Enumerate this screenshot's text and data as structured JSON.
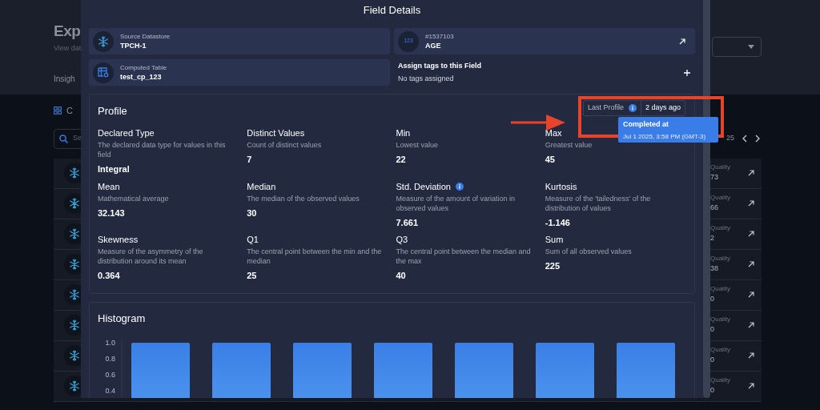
{
  "background_page": {
    "title": "Exp",
    "subtitle": "View dat",
    "tab": "Insigh",
    "section_label": "C",
    "search_placeholder": "Se",
    "pagination": "25",
    "rows": [
      {
        "quality_label": "Quality",
        "quality": "73"
      },
      {
        "quality_label": "Quality",
        "quality": "66"
      },
      {
        "quality_label": "Quality",
        "quality": "2"
      },
      {
        "quality_label": "Quality",
        "quality": "38"
      },
      {
        "quality_label": "Quality",
        "quality": "0"
      },
      {
        "quality_label": "Quality",
        "quality": "0"
      },
      {
        "quality_label": "Quality",
        "quality": "0"
      },
      {
        "quality_label": "Quality",
        "quality": "0"
      }
    ]
  },
  "modal": {
    "title": "Field Details",
    "cards": [
      {
        "kind": "datastore",
        "label": "Source Datastore",
        "value": "TPCH-1"
      },
      {
        "kind": "field",
        "label": "#1537103",
        "value": "AGE",
        "icon_text": "123"
      },
      {
        "kind": "table",
        "label": "Computed Table",
        "value": "test_cp_123"
      }
    ],
    "tags": {
      "title": "Assign tags to this Field",
      "value": "No tags assigned"
    },
    "profile": {
      "title": "Profile",
      "last_profile": {
        "label": "Last Profile",
        "value": "2 days ago"
      },
      "tooltip": {
        "title": "Completed at",
        "value": "Jul 1 2025, 3:58 PM (GMT-3)"
      },
      "stats": [
        {
          "name": "Declared Type",
          "description": "The declared data type for values in this field",
          "value": "Integral",
          "info": false
        },
        {
          "name": "Distinct Values",
          "description": "Count of distinct values",
          "value": "7",
          "info": false
        },
        {
          "name": "Min",
          "description": "Lowest value",
          "value": "22",
          "info": false
        },
        {
          "name": "Max",
          "description": "Greatest value",
          "value": "45",
          "info": false
        },
        {
          "name": "Mean",
          "description": "Mathematical average",
          "value": "32.143",
          "info": false
        },
        {
          "name": "Median",
          "description": "The median of the observed values",
          "value": "30",
          "info": false
        },
        {
          "name": "Std. Deviation",
          "description": "Measure of the amount of variation in observed values",
          "value": "7.661",
          "info": true
        },
        {
          "name": "Kurtosis",
          "description": "Measure of the 'tailedness' of the distribution of values",
          "value": "-1.146",
          "info": false
        },
        {
          "name": "Skewness",
          "description": "Measure of the asymmetry of the distribution around its mean",
          "value": "0.364",
          "info": false
        },
        {
          "name": "Q1",
          "description": "The central point between the min and the median",
          "value": "25",
          "info": false
        },
        {
          "name": "Q3",
          "description": "The central point between the median and the max",
          "value": "40",
          "info": false
        },
        {
          "name": "Sum",
          "description": "Sum of all observed values",
          "value": "225",
          "info": false
        }
      ]
    },
    "histogram": {
      "title": "Histogram",
      "axis_labels": [
        "1.0",
        "0.8",
        "0.6",
        "0.4"
      ]
    }
  }
}
